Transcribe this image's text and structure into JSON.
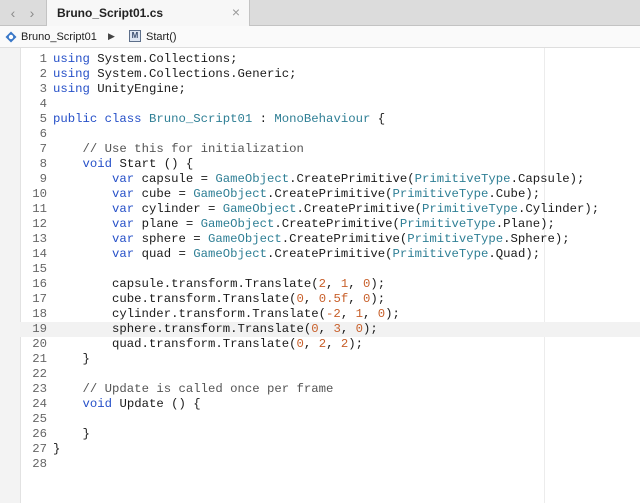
{
  "tabs": [
    {
      "label": "Bruno_Script01.cs",
      "close_glyph": "×"
    }
  ],
  "nav": {
    "back_glyph": "‹",
    "forward_glyph": "›"
  },
  "breadcrumb": {
    "file": "Bruno_Script01",
    "separator": "▶",
    "method": "Start()",
    "method_icon_letter": "M"
  },
  "colors": {
    "keyword": "#2650c8",
    "type": "#2f7f95",
    "number": "#c8602b",
    "comment": "#555555",
    "text": "#1a1a1a"
  },
  "editor": {
    "cursor_line": 19,
    "lines": [
      {
        "n": "1",
        "tokens": [
          [
            "kw",
            "using"
          ],
          [
            "tx",
            " System.Collections;"
          ]
        ]
      },
      {
        "n": "2",
        "tokens": [
          [
            "kw",
            "using"
          ],
          [
            "tx",
            " System.Collections.Generic;"
          ]
        ]
      },
      {
        "n": "3",
        "tokens": [
          [
            "kw",
            "using"
          ],
          [
            "tx",
            " UnityEngine;"
          ]
        ]
      },
      {
        "n": "4",
        "tokens": []
      },
      {
        "n": "5",
        "tokens": [
          [
            "kw",
            "public class"
          ],
          [
            "tx",
            " "
          ],
          [
            "ty",
            "Bruno_Script01"
          ],
          [
            "tx",
            " : "
          ],
          [
            "ty",
            "MonoBehaviour"
          ],
          [
            "tx",
            " {"
          ]
        ]
      },
      {
        "n": "6",
        "tokens": []
      },
      {
        "n": "7",
        "tokens": [
          [
            "tx",
            "    "
          ],
          [
            "cm",
            "// Use this for initialization"
          ]
        ]
      },
      {
        "n": "8",
        "tokens": [
          [
            "tx",
            "    "
          ],
          [
            "kw",
            "void"
          ],
          [
            "tx",
            " Start () {"
          ]
        ]
      },
      {
        "n": "9",
        "tokens": [
          [
            "tx",
            "        "
          ],
          [
            "kw",
            "var"
          ],
          [
            "tx",
            " capsule = "
          ],
          [
            "ty",
            "GameObject"
          ],
          [
            "tx",
            ".CreatePrimitive("
          ],
          [
            "ty",
            "PrimitiveType"
          ],
          [
            "tx",
            ".Capsule);"
          ]
        ]
      },
      {
        "n": "10",
        "tokens": [
          [
            "tx",
            "        "
          ],
          [
            "kw",
            "var"
          ],
          [
            "tx",
            " cube = "
          ],
          [
            "ty",
            "GameObject"
          ],
          [
            "tx",
            ".CreatePrimitive("
          ],
          [
            "ty",
            "PrimitiveType"
          ],
          [
            "tx",
            ".Cube);"
          ]
        ]
      },
      {
        "n": "11",
        "tokens": [
          [
            "tx",
            "        "
          ],
          [
            "kw",
            "var"
          ],
          [
            "tx",
            " cylinder = "
          ],
          [
            "ty",
            "GameObject"
          ],
          [
            "tx",
            ".CreatePrimitive("
          ],
          [
            "ty",
            "PrimitiveType"
          ],
          [
            "tx",
            ".Cylinder);"
          ]
        ]
      },
      {
        "n": "12",
        "tokens": [
          [
            "tx",
            "        "
          ],
          [
            "kw",
            "var"
          ],
          [
            "tx",
            " plane = "
          ],
          [
            "ty",
            "GameObject"
          ],
          [
            "tx",
            ".CreatePrimitive("
          ],
          [
            "ty",
            "PrimitiveType"
          ],
          [
            "tx",
            ".Plane);"
          ]
        ]
      },
      {
        "n": "13",
        "tokens": [
          [
            "tx",
            "        "
          ],
          [
            "kw",
            "var"
          ],
          [
            "tx",
            " sphere = "
          ],
          [
            "ty",
            "GameObject"
          ],
          [
            "tx",
            ".CreatePrimitive("
          ],
          [
            "ty",
            "PrimitiveType"
          ],
          [
            "tx",
            ".Sphere);"
          ]
        ]
      },
      {
        "n": "14",
        "tokens": [
          [
            "tx",
            "        "
          ],
          [
            "kw",
            "var"
          ],
          [
            "tx",
            " quad = "
          ],
          [
            "ty",
            "GameObject"
          ],
          [
            "tx",
            ".CreatePrimitive("
          ],
          [
            "ty",
            "PrimitiveType"
          ],
          [
            "tx",
            ".Quad);"
          ]
        ]
      },
      {
        "n": "15",
        "tokens": []
      },
      {
        "n": "16",
        "tokens": [
          [
            "tx",
            "        capsule.transform.Translate("
          ],
          [
            "nu",
            "2"
          ],
          [
            "tx",
            ", "
          ],
          [
            "nu",
            "1"
          ],
          [
            "tx",
            ", "
          ],
          [
            "nu",
            "0"
          ],
          [
            "tx",
            ");"
          ]
        ]
      },
      {
        "n": "17",
        "tokens": [
          [
            "tx",
            "        cube.transform.Translate("
          ],
          [
            "nu",
            "0"
          ],
          [
            "tx",
            ", "
          ],
          [
            "nu",
            "0.5f"
          ],
          [
            "tx",
            ", "
          ],
          [
            "nu",
            "0"
          ],
          [
            "tx",
            ");"
          ]
        ]
      },
      {
        "n": "18",
        "tokens": [
          [
            "tx",
            "        cylinder.transform.Translate("
          ],
          [
            "nu",
            "-2"
          ],
          [
            "tx",
            ", "
          ],
          [
            "nu",
            "1"
          ],
          [
            "tx",
            ", "
          ],
          [
            "nu",
            "0"
          ],
          [
            "tx",
            ");"
          ]
        ]
      },
      {
        "n": "19",
        "tokens": [
          [
            "tx",
            "        sphere.transform.Translate("
          ],
          [
            "nu",
            "0"
          ],
          [
            "tx",
            ", "
          ],
          [
            "nu",
            "3"
          ],
          [
            "tx",
            ", "
          ],
          [
            "nu",
            "0"
          ],
          [
            "tx",
            ");"
          ]
        ]
      },
      {
        "n": "20",
        "tokens": [
          [
            "tx",
            "        quad.transform.Translate("
          ],
          [
            "nu",
            "0"
          ],
          [
            "tx",
            ", "
          ],
          [
            "nu",
            "2"
          ],
          [
            "tx",
            ", "
          ],
          [
            "nu",
            "2"
          ],
          [
            "tx",
            ");"
          ]
        ]
      },
      {
        "n": "21",
        "tokens": [
          [
            "tx",
            "    }"
          ]
        ]
      },
      {
        "n": "22",
        "tokens": []
      },
      {
        "n": "23",
        "tokens": [
          [
            "tx",
            "    "
          ],
          [
            "cm",
            "// Update is called once per frame"
          ]
        ]
      },
      {
        "n": "24",
        "tokens": [
          [
            "tx",
            "    "
          ],
          [
            "kw",
            "void"
          ],
          [
            "tx",
            " Update () {"
          ]
        ]
      },
      {
        "n": "25",
        "tokens": []
      },
      {
        "n": "26",
        "tokens": [
          [
            "tx",
            "    }"
          ]
        ]
      },
      {
        "n": "27",
        "tokens": [
          [
            "tx",
            "}"
          ]
        ]
      },
      {
        "n": "28",
        "tokens": []
      }
    ]
  }
}
